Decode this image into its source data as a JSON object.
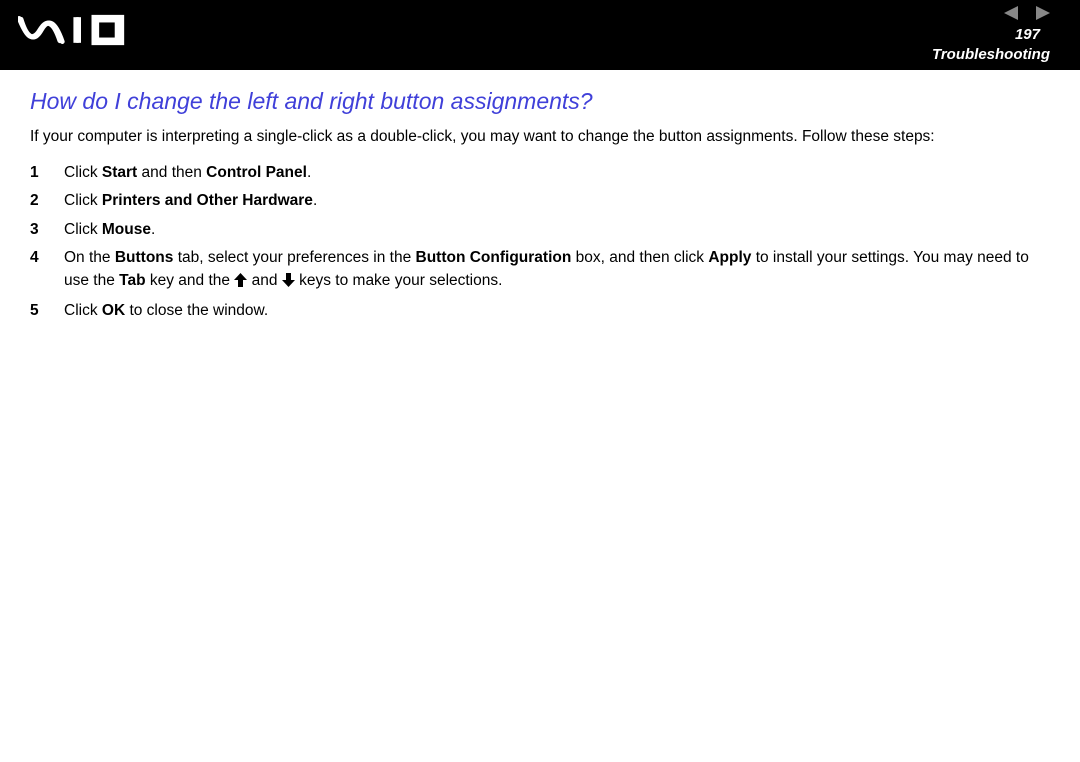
{
  "header": {
    "page_number": "197",
    "section": "Troubleshooting"
  },
  "title": "How do I change the left and right button assignments?",
  "intro": "If your computer is interpreting a single-click as a double-click, you may want to change the button assignments. Follow these steps:",
  "steps": {
    "s1_a": "Click ",
    "s1_b1": "Start",
    "s1_c": " and then ",
    "s1_b2": "Control Panel",
    "s1_d": ".",
    "s2_a": "Click ",
    "s2_b1": "Printers and Other Hardware",
    "s2_c": ".",
    "s3_a": "Click ",
    "s3_b1": "Mouse",
    "s3_c": ".",
    "s4_a": "On the ",
    "s4_b1": "Buttons",
    "s4_c": " tab, select your preferences in the ",
    "s4_b2": "Button Configuration",
    "s4_d": " box, and then click ",
    "s4_b3": "Apply",
    "s4_e": " to install your settings. You may need to use the ",
    "s4_b4": "Tab",
    "s4_f": " key and the ",
    "s4_g": " and ",
    "s4_h": " keys to make your selections.",
    "s5_a": "Click ",
    "s5_b1": "OK",
    "s5_c": " to close the window."
  }
}
